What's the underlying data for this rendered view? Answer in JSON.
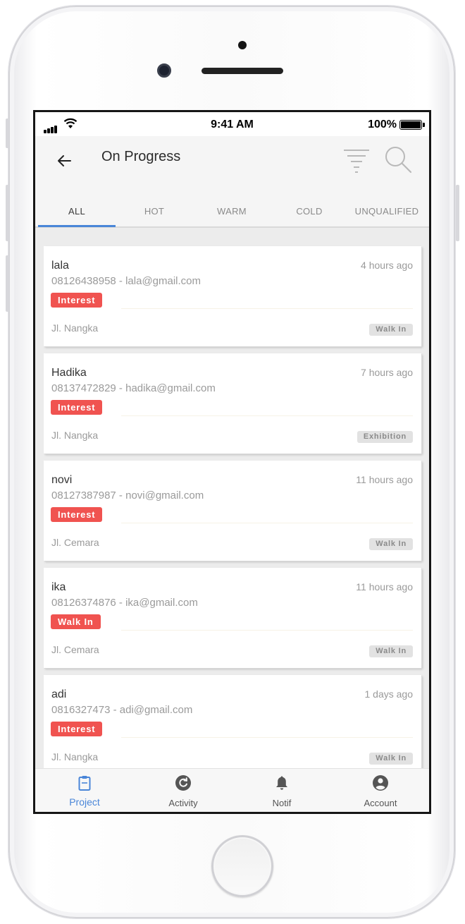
{
  "status_bar": {
    "time": "9:41 AM",
    "battery": "100%"
  },
  "header": {
    "title": "On Progress"
  },
  "tabs": [
    {
      "label": "ALL",
      "active": true
    },
    {
      "label": "HOT",
      "active": false
    },
    {
      "label": "WARM",
      "active": false
    },
    {
      "label": "COLD",
      "active": false
    },
    {
      "label": "UNQUALIFIED",
      "active": false
    }
  ],
  "leads": [
    {
      "name": "lala",
      "time": "4 hours ago",
      "contact": "08126438958 - lala@gmail.com",
      "status": "Interest",
      "address": "Jl. Nangka",
      "source": "Walk In"
    },
    {
      "name": "Hadika",
      "time": "7 hours ago",
      "contact": "08137472829 - hadika@gmail.com",
      "status": "Interest",
      "address": "Jl. Nangka",
      "source": "Exhibition"
    },
    {
      "name": "novi",
      "time": "11 hours ago",
      "contact": "08127387987 - novi@gmail.com",
      "status": "Interest",
      "address": "Jl. Cemara",
      "source": "Walk In"
    },
    {
      "name": "ika",
      "time": "11 hours ago",
      "contact": "08126374876 - ika@gmail.com",
      "status": "Walk In",
      "address": "Jl. Cemara",
      "source": "Walk In"
    },
    {
      "name": "adi",
      "time": "1 days ago",
      "contact": "0816327473 - adi@gmail.com",
      "status": "Interest",
      "address": "Jl. Nangka",
      "source": "Walk In"
    }
  ],
  "bottom_nav": [
    {
      "label": "Project",
      "icon": "clipboard-icon",
      "active": true
    },
    {
      "label": "Activity",
      "icon": "refresh-circle-icon",
      "active": false
    },
    {
      "label": "Notif",
      "icon": "bell-icon",
      "active": false
    },
    {
      "label": "Account",
      "icon": "account-circle-icon",
      "active": false
    }
  ],
  "colors": {
    "accent": "#4a86d8",
    "status_badge": "#f05350",
    "source_badge": "#e2e2e2"
  }
}
